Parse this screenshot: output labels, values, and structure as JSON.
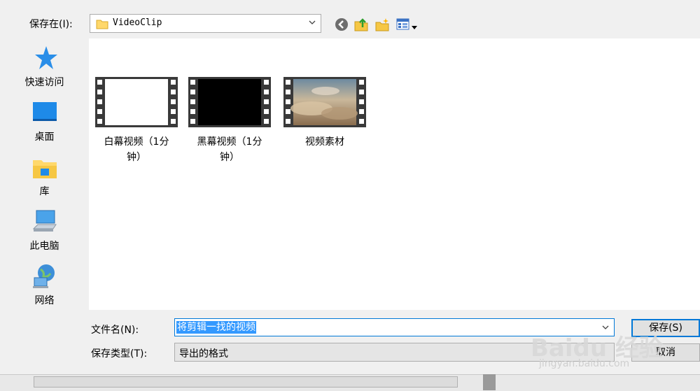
{
  "save_in_label": "保存在(I):",
  "location": {
    "folder": "VideoClip"
  },
  "places": [
    {
      "label": "快速访问",
      "icon": "star-icon"
    },
    {
      "label": "桌面",
      "icon": "desktop-icon"
    },
    {
      "label": "库",
      "icon": "library-icon"
    },
    {
      "label": "此电脑",
      "icon": "computer-icon"
    },
    {
      "label": "网络",
      "icon": "network-icon"
    }
  ],
  "files": [
    {
      "name": "白幕视频（1分钟）",
      "line1": "白幕视频（1分",
      "line2": "钟）",
      "thumb": "white"
    },
    {
      "name": "黑幕视频（1分钟）",
      "line1": "黑幕视频（1分",
      "line2": "钟）",
      "thumb": "black"
    },
    {
      "name": "视频素材",
      "line1": "视频素材",
      "line2": "",
      "thumb": "landscape"
    }
  ],
  "filename": {
    "label": "文件名(N):",
    "value": "将剪辑一找的视频"
  },
  "filetype": {
    "label": "保存类型(T):",
    "value": "导出的格式"
  },
  "buttons": {
    "save": "保存(S)",
    "cancel": "取消"
  },
  "watermark": {
    "brand": "Baidu 经验",
    "url": "jingyan.baidu.com"
  },
  "colors": {
    "selection": "#3399ff",
    "accent": "#0078d7"
  }
}
